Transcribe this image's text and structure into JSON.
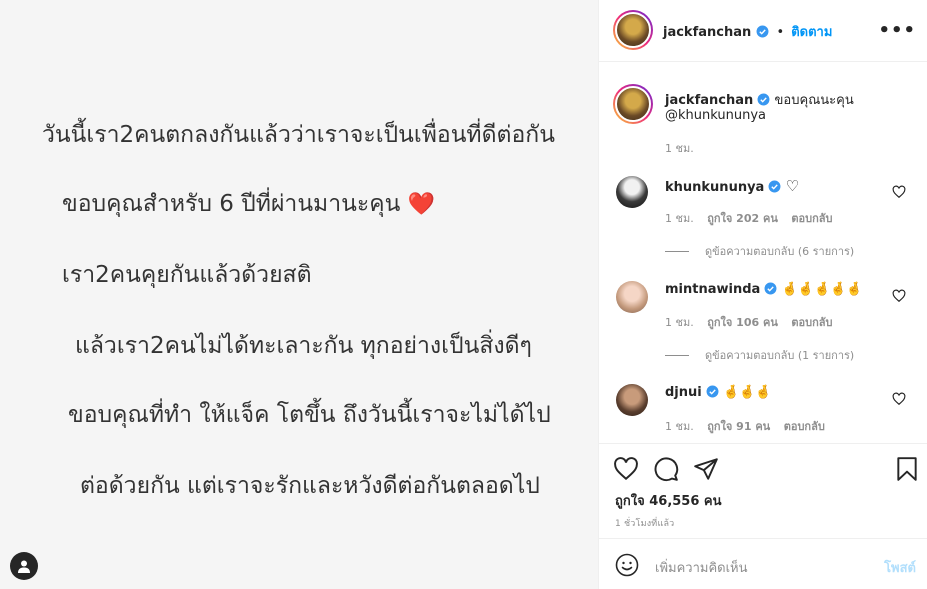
{
  "image": {
    "lines": [
      "วันนี้เรา2คนตกลงกันแล้วว่าเราจะเป็นเพื่อนที่ดีต่อกัน",
      "ขอบคุณสำหรับ 6 ปีที่ผ่านมานะคุน",
      "เรา2คนคุยกันแล้วด้วยสติ",
      "แล้วเรา2คนไม่ได้ทะเลาะกัน ทุกอย่างเป็นสิ่งดีๆ",
      "ขอบคุณที่ทำ ให้แจ็ค โตขึ้น  ถึงวันนี้เราจะไม่ได้ไป",
      "ต่อด้วยกัน แต่เราจะรักและหวังดีต่อกันตลอดไป"
    ],
    "heart": "❤️"
  },
  "header": {
    "username": "jackfanchan",
    "separator": "•",
    "follow_label": "ติดตาม",
    "more": "•••"
  },
  "caption": {
    "username": "jackfanchan",
    "text": "ขอบคุณนะคุน",
    "mention": "@khunkununya",
    "time": "1 ชม."
  },
  "comments": [
    {
      "username": "khunkununya",
      "text": "♡",
      "time": "1 ชม.",
      "likes": "ถูกใจ 202 คน",
      "reply_label": "ตอบกลับ",
      "view_replies": "ดูข้อความตอบกลับ (6 รายการ)"
    },
    {
      "username": "mintnawinda",
      "text": "🤞🤞🤞🤞🤞",
      "time": "1 ชม.",
      "likes": "ถูกใจ 106 คน",
      "reply_label": "ตอบกลับ",
      "view_replies": "ดูข้อความตอบกลับ (1 รายการ)"
    },
    {
      "username": "djnui",
      "text": "🤞🤞🤞",
      "time": "1 ชม.",
      "likes": "ถูกใจ 91 คน",
      "reply_label": "ตอบกลับ"
    }
  ],
  "actions": {
    "likes": "ถูกใจ 46,556 คน",
    "timestamp": "1 ชั่วโมงที่แล้ว"
  },
  "comment_box": {
    "placeholder": "เพิ่มความคิดเห็น",
    "post_label": "โพสต์"
  },
  "colors": {
    "accent": "#0095f6",
    "verified": "#3897f0",
    "heart": "#e8262d",
    "muted": "#8e8e8e"
  }
}
